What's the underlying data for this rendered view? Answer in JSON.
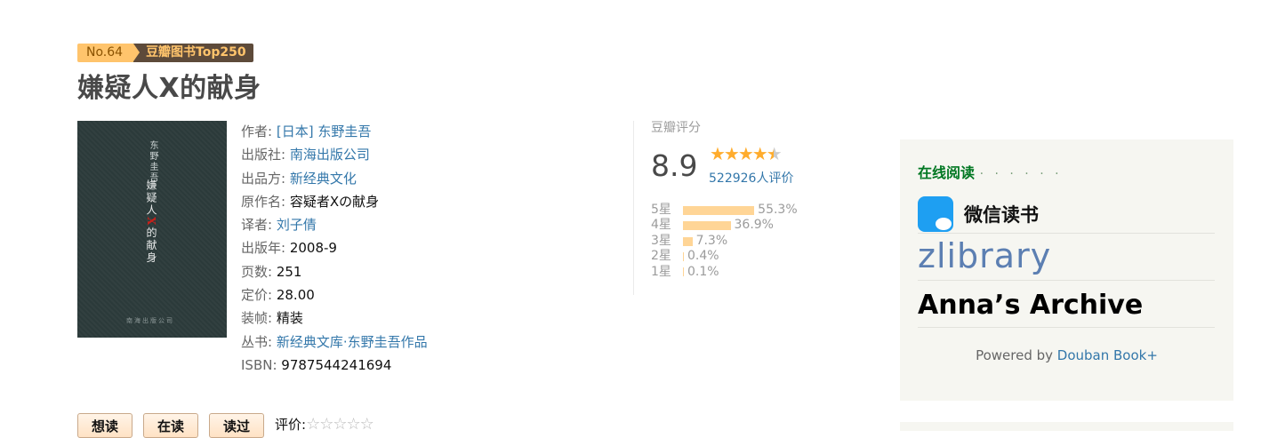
{
  "badge": {
    "rank": "No.64",
    "list": "豆瓣图书Top250"
  },
  "title": "嫌疑人X的献身",
  "cover": {
    "author": "东野圭吾",
    "title_pre": "嫌疑人",
    "title_x": "X",
    "title_post": "的献身",
    "publisher": "南海出版公司"
  },
  "info": {
    "author": {
      "label": "作者",
      "value": "[日本] 东野圭吾"
    },
    "publisher": {
      "label": "出版社",
      "value": "南海出版公司"
    },
    "producer": {
      "label": "出品方",
      "value": "新经典文化"
    },
    "original_title": {
      "label": "原作名",
      "value": "容疑者Xの献身"
    },
    "translator": {
      "label": "译者",
      "value": "刘子倩"
    },
    "pub_year": {
      "label": "出版年",
      "value": "2008-9"
    },
    "pages": {
      "label": "页数",
      "value": "251"
    },
    "price": {
      "label": "定价",
      "value": "28.00"
    },
    "binding": {
      "label": "装帧",
      "value": "精装"
    },
    "series": {
      "label": "丛书",
      "value": "新经典文库·东野圭吾作品"
    },
    "isbn": {
      "label": "ISBN",
      "value": "9787544241694"
    }
  },
  "rating": {
    "label": "豆瓣评分",
    "score": "8.9",
    "stars": 4.5,
    "count": "522926人评价",
    "breakdown": [
      {
        "label": "5星",
        "percent": "55.3%",
        "value": 55.3
      },
      {
        "label": "4星",
        "percent": "36.9%",
        "value": 36.9
      },
      {
        "label": "3星",
        "percent": "7.3%",
        "value": 7.3
      },
      {
        "label": "2星",
        "percent": "0.4%",
        "value": 0.4
      },
      {
        "label": "1星",
        "percent": "0.1%",
        "value": 0.1
      }
    ]
  },
  "sidebar": {
    "heading": "在线阅读",
    "dots": "· · · · · ·",
    "weixin": "微信读书",
    "zlibrary": "zlibrary",
    "anna": "Anna’s Archive",
    "powered_prefix": "Powered by ",
    "powered_link": "Douban Book+"
  },
  "actions": {
    "want": "想读",
    "reading": "在读",
    "read": "读过",
    "rate_label": "评价:"
  },
  "colors": {
    "link": "#3377aa",
    "bar": "#ffd596",
    "star": "#ffac2d",
    "green": "#007722"
  }
}
